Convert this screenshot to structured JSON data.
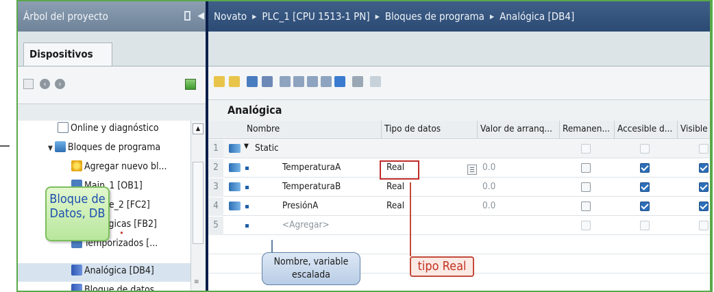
{
  "left_panel": {
    "title": "Árbol del proyecto",
    "tab": "Dispositivos",
    "tree": [
      {
        "label": "Online y diagnóstico",
        "icon": "diagnostics-icon"
      },
      {
        "label": "Bloques de programa",
        "icon": "folder-icon",
        "expanded": true
      },
      {
        "label": "Agregar nuevo bl...",
        "icon": "add-block-icon"
      },
      {
        "label": "Main_1 [OB1]",
        "icon": "ob-icon"
      },
      {
        "label": "Bloque_2 [FC2]",
        "icon": "fc-icon"
      },
      {
        "label": "Analógicas [FB2]",
        "icon": "fb-icon"
      },
      {
        "label": "Temporizados [...",
        "icon": "fb-icon"
      },
      {
        "label": "Analógica [DB4]",
        "icon": "db-icon",
        "selected": true
      },
      {
        "label": "Bloque de datos",
        "icon": "db-icon"
      }
    ]
  },
  "breadcrumb": [
    "Novato",
    "PLC_1 [CPU 1513-1 PN]",
    "Bloques de programa",
    "Analógica [DB4]"
  ],
  "block_title": "Analógica",
  "grid": {
    "columns": [
      "Nombre",
      "Tipo de datos",
      "Valor de arranq...",
      "Remanen...",
      "Accesible d...",
      "Visible"
    ],
    "rows": [
      {
        "num": "1",
        "name": "Static",
        "type": "",
        "start": "",
        "retain": false,
        "accessible": false,
        "visible": false,
        "header": true
      },
      {
        "num": "2",
        "name": "TemperaturaA",
        "type": "Real",
        "start": "0.0",
        "retain": false,
        "accessible": true,
        "visible": true
      },
      {
        "num": "3",
        "name": "TemperaturaB",
        "type": "Real",
        "start": "0.0",
        "retain": false,
        "accessible": true,
        "visible": true
      },
      {
        "num": "4",
        "name": "PresiónA",
        "type": "Real",
        "start": "0.0",
        "retain": false,
        "accessible": true,
        "visible": true
      },
      {
        "num": "5",
        "name": "<Agregar>",
        "type": "",
        "start": "",
        "retain": false,
        "accessible": false,
        "visible": false,
        "add_row": true
      }
    ]
  },
  "callouts": {
    "db": "Bloque de Datos, DB",
    "name": "Nombre, variable escalada",
    "type": "tipo Real"
  },
  "colors": {
    "frame": "#5aa84a",
    "title_bar": "#2b4a74",
    "highlight": "#c02929"
  }
}
